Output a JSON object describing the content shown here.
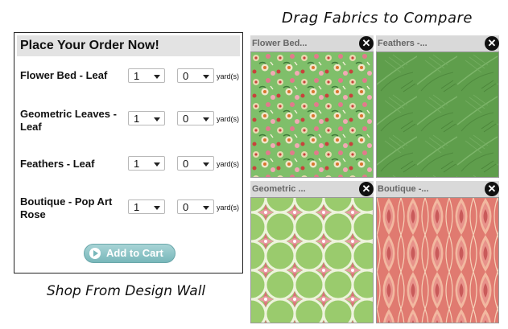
{
  "drag_title": "Drag Fabrics to Compare",
  "shop_caption": "Shop From Design Wall",
  "order": {
    "header": "Place Your Order Now!",
    "rows": [
      {
        "name": "Flower Bed - Leaf",
        "qty": "1",
        "fraction": "0",
        "unit": "yard(s)"
      },
      {
        "name": "Geometric Leaves - Leaf",
        "qty": "1",
        "fraction": "0",
        "unit": "yard(s)"
      },
      {
        "name": "Feathers - Leaf",
        "qty": "1",
        "fraction": "0",
        "unit": "yard(s)"
      },
      {
        "name": "Boutique - Pop Art Rose",
        "qty": "1",
        "fraction": "0",
        "unit": "yard(s)"
      }
    ],
    "add_to_cart": "Add to Cart"
  },
  "fabrics": [
    {
      "title": "Flower Bed...",
      "close": "✕"
    },
    {
      "title": "Feathers -...",
      "close": "✕"
    },
    {
      "title": "Geometric ...",
      "close": "✕"
    },
    {
      "title": "Boutique -...",
      "close": "✕"
    }
  ],
  "colors": {
    "button": "#78b7ba",
    "panel_header": "#e3e3e3",
    "flower_bg": "#7fbf6a",
    "feathers_bg": "#5f9e4c",
    "geometric_bg": "#9acb6d",
    "boutique_bg": "#e07a70"
  }
}
